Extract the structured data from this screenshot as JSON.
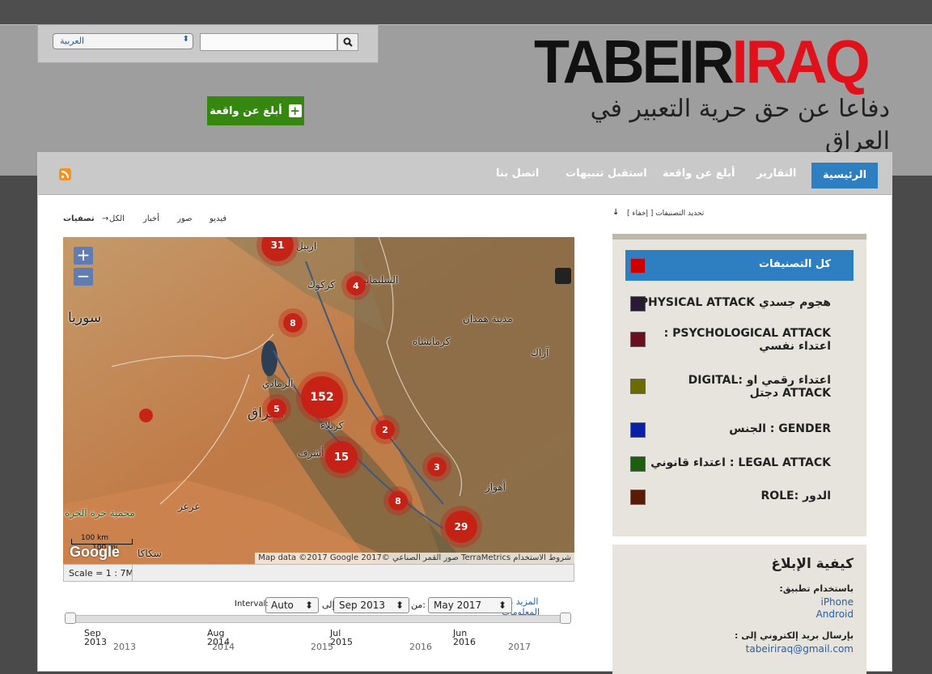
{
  "header": {
    "language": "العربية",
    "search_placeholder": "",
    "report_button": "أبلغ عن واقعة",
    "logo_black": "TABEIR",
    "logo_red": "IRAQ",
    "tagline": "دفاعا عن حق حرية التعبير في العراق"
  },
  "nav": {
    "items": [
      "الرئيسية",
      "التقارير",
      "أبلغ عن واقعة",
      "استقبل تنبيهات",
      "اتصل بنا"
    ]
  },
  "filters": {
    "label": "تصفيات",
    "arrow": "→",
    "options": [
      "الكل",
      "أخبار",
      "صور",
      "فيديو"
    ]
  },
  "map": {
    "labels": {
      "syria": "سوريا",
      "iraq": "العراق",
      "erbil": "اربيل",
      "kirkuk": "كركوك",
      "sulaymaniyah": "السليمانية",
      "hamadan": "مدينة همدان",
      "kermanshah": "كرمانشاه",
      "arak": "آراك",
      "ramadi": "الرمادي",
      "karbala": "كربلاء",
      "najaf": "أشرف",
      "ahvaz": "أهواز",
      "arar": "عرعر",
      "harrat": "محمية حرة الحرة",
      "sakaka": "سكاكا"
    },
    "clusters": [
      {
        "count": "31"
      },
      {
        "count": "4"
      },
      {
        "count": "8"
      },
      {
        "count": "152"
      },
      {
        "count": "5"
      },
      {
        "count": "2"
      },
      {
        "count": "15"
      },
      {
        "count": "3"
      },
      {
        "count": "8"
      },
      {
        "count": "29"
      },
      {
        "count": ""
      }
    ],
    "zoom_in": "+",
    "zoom_out": "−",
    "scale_km": "100 km",
    "scale_mi": "100 mi",
    "google": "Google",
    "attribution": "Map data ©2017 Google 2017© صور القمر الصناعي TerraMetrics شروط الاستخدام",
    "scale_text": "Scale = 1 : 7M"
  },
  "timeline": {
    "more_info": "المزيد من المعلومات",
    "from_label": "من:",
    "from_value": "May 2017",
    "to_label": "إلى",
    "to_value": "Sep 2013",
    "interval_label": "Interval:",
    "interval_value": "Auto",
    "ticks_top": [
      "Sep\n2013",
      "Aug\n2014",
      "Jul\n2015",
      "Jun\n2016"
    ],
    "ticks_bottom": [
      "2013",
      "2014",
      "2015",
      "2016",
      "2017"
    ]
  },
  "sidebar": {
    "categories_toggle": "[ تحديد التصنيفات [ إخفاء",
    "toggle_arrow": "↓",
    "categories": [
      {
        "label": "كل التصنيفات",
        "color": "#cc0000"
      },
      {
        "label": "هجوم جسدي PHYSICAL ATTACK",
        "color": "#2a1a3a"
      },
      {
        "label": "PSYCHOLOGICAL ATTACK : اعتداء نفسي",
        "color": "#6a0f1f"
      },
      {
        "label": "اعتداء رقمي او :DIGITAL ATTACK دجتل",
        "color": "#6b6b00"
      },
      {
        "label": "GENDER : الجنس",
        "color": "#0a1fa8"
      },
      {
        "label": "LEGAL ATTACK : اعتداء قانوني",
        "color": "#1d5f10"
      },
      {
        "label": "الدور :ROLE",
        "color": "#5a1a08"
      }
    ],
    "how_title": "كيفية الإبلاغ",
    "via_app": ":باستخدام تطبيق",
    "iphone": "iPhone",
    "android": "Android",
    "via_email": ": بإرسال بريد إلكتروني إلى",
    "email": "tabeiriraq@gmail.com"
  },
  "colors": {
    "accent": "#2d7fc1",
    "report_green": "#36870f",
    "logo_red": "#e0111b"
  }
}
